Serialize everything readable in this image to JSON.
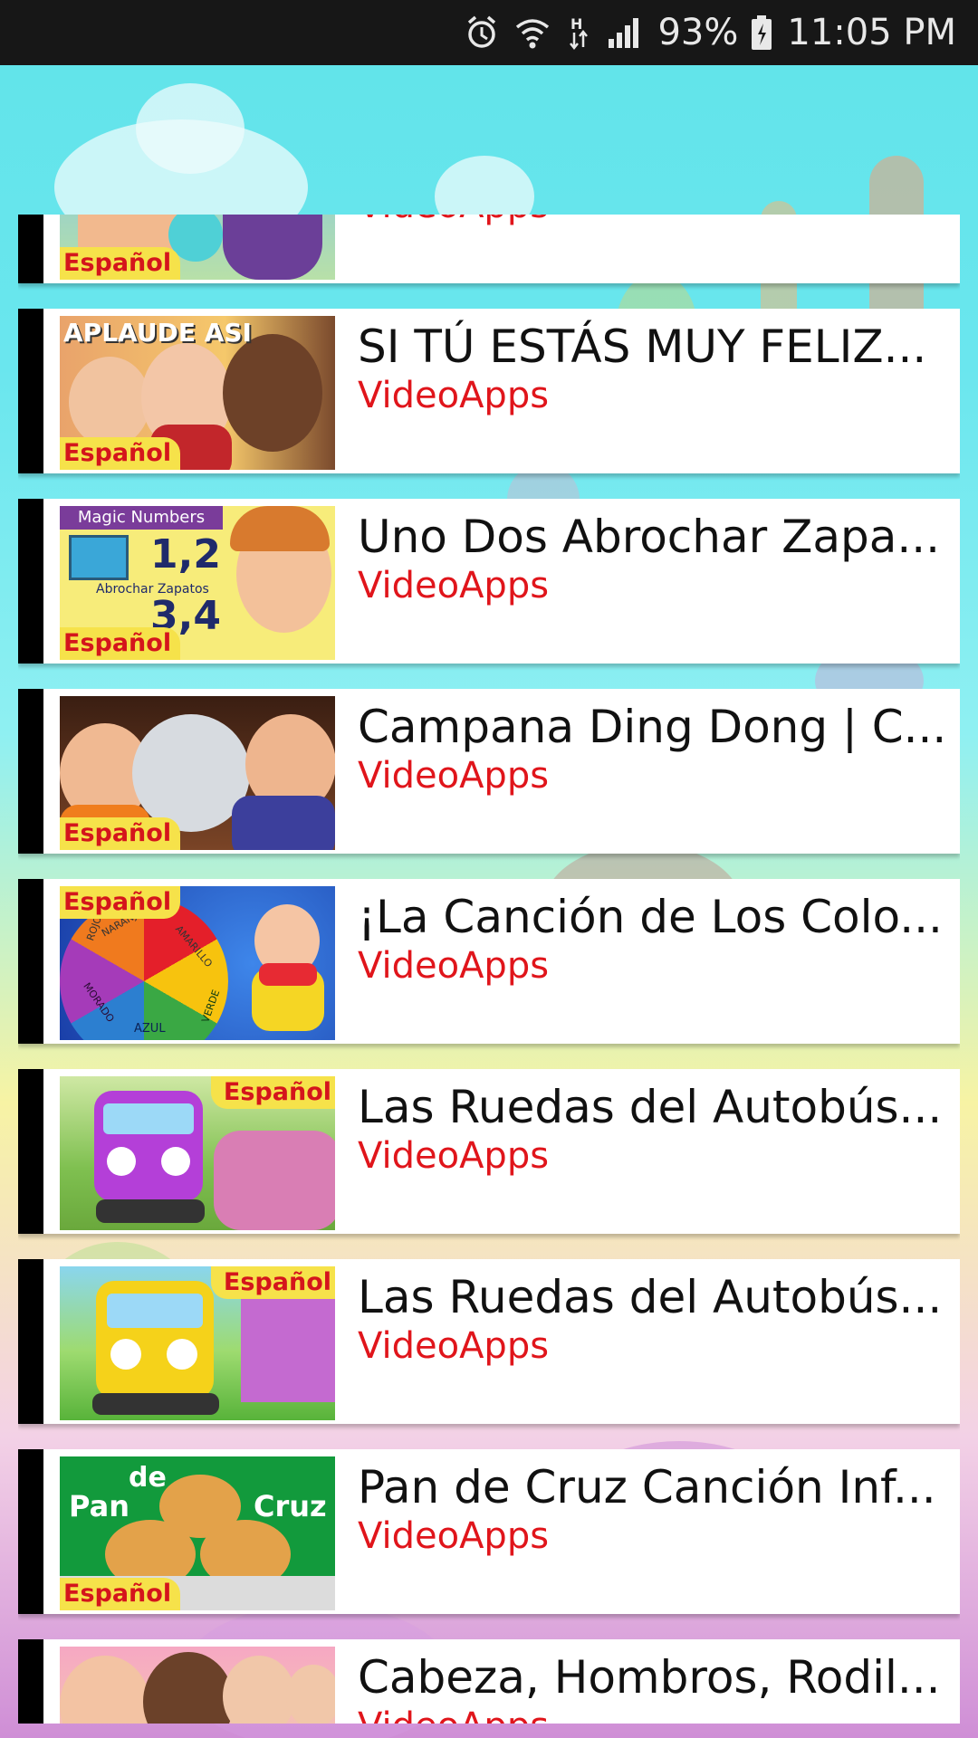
{
  "status_bar": {
    "battery_percent": "93%",
    "time": "11:05 PM",
    "icons": [
      "alarm-icon",
      "wifi-icon",
      "h-data-icon",
      "signal-icon",
      "battery-icon"
    ]
  },
  "list": {
    "items": [
      {
        "title": "",
        "channel": "VideoApps",
        "badge": "Español",
        "thumbnail": "finger-family"
      },
      {
        "title": "SI TÚ ESTÁS MUY FELIZ...",
        "channel": "VideoApps",
        "badge": "Español",
        "thumbnail_caption": "APLAUDE ASI"
      },
      {
        "title": "Uno Dos Abrochar Zapa...",
        "channel": "VideoApps",
        "badge": "Español",
        "thumbnail_caption": "Magic Numbers",
        "thumb_numbers": [
          "1,2",
          "3,4"
        ],
        "thumb_subcaption": "Abrochar Zapatos"
      },
      {
        "title": "Campana Ding Dong | C...",
        "channel": "VideoApps",
        "badge": "Español"
      },
      {
        "title": "¡La Canción de Los Colo...",
        "channel": "VideoApps",
        "badge": "Español",
        "wheel_labels": [
          "ROJO",
          "NARANJA",
          "AMARILLO",
          "VERDE",
          "AZUL",
          "MORADO"
        ]
      },
      {
        "title": "Las Ruedas del Autobús...",
        "channel": "VideoApps",
        "badge": "Español"
      },
      {
        "title": "Las Ruedas del Autobús...",
        "channel": "VideoApps",
        "badge": "Español"
      },
      {
        "title": "Pan de Cruz Canción Inf...",
        "channel": "VideoApps",
        "badge": "Español",
        "thumb_words": [
          "Pan",
          "de",
          "Cruz"
        ]
      },
      {
        "title": "Cabeza, Hombros, Rodil...",
        "channel": "VideoApps",
        "badge": ""
      }
    ]
  },
  "colors": {
    "accent_red": "#e0151b",
    "badge_yellow": "#f6e24a",
    "status_bar": "#171717"
  }
}
